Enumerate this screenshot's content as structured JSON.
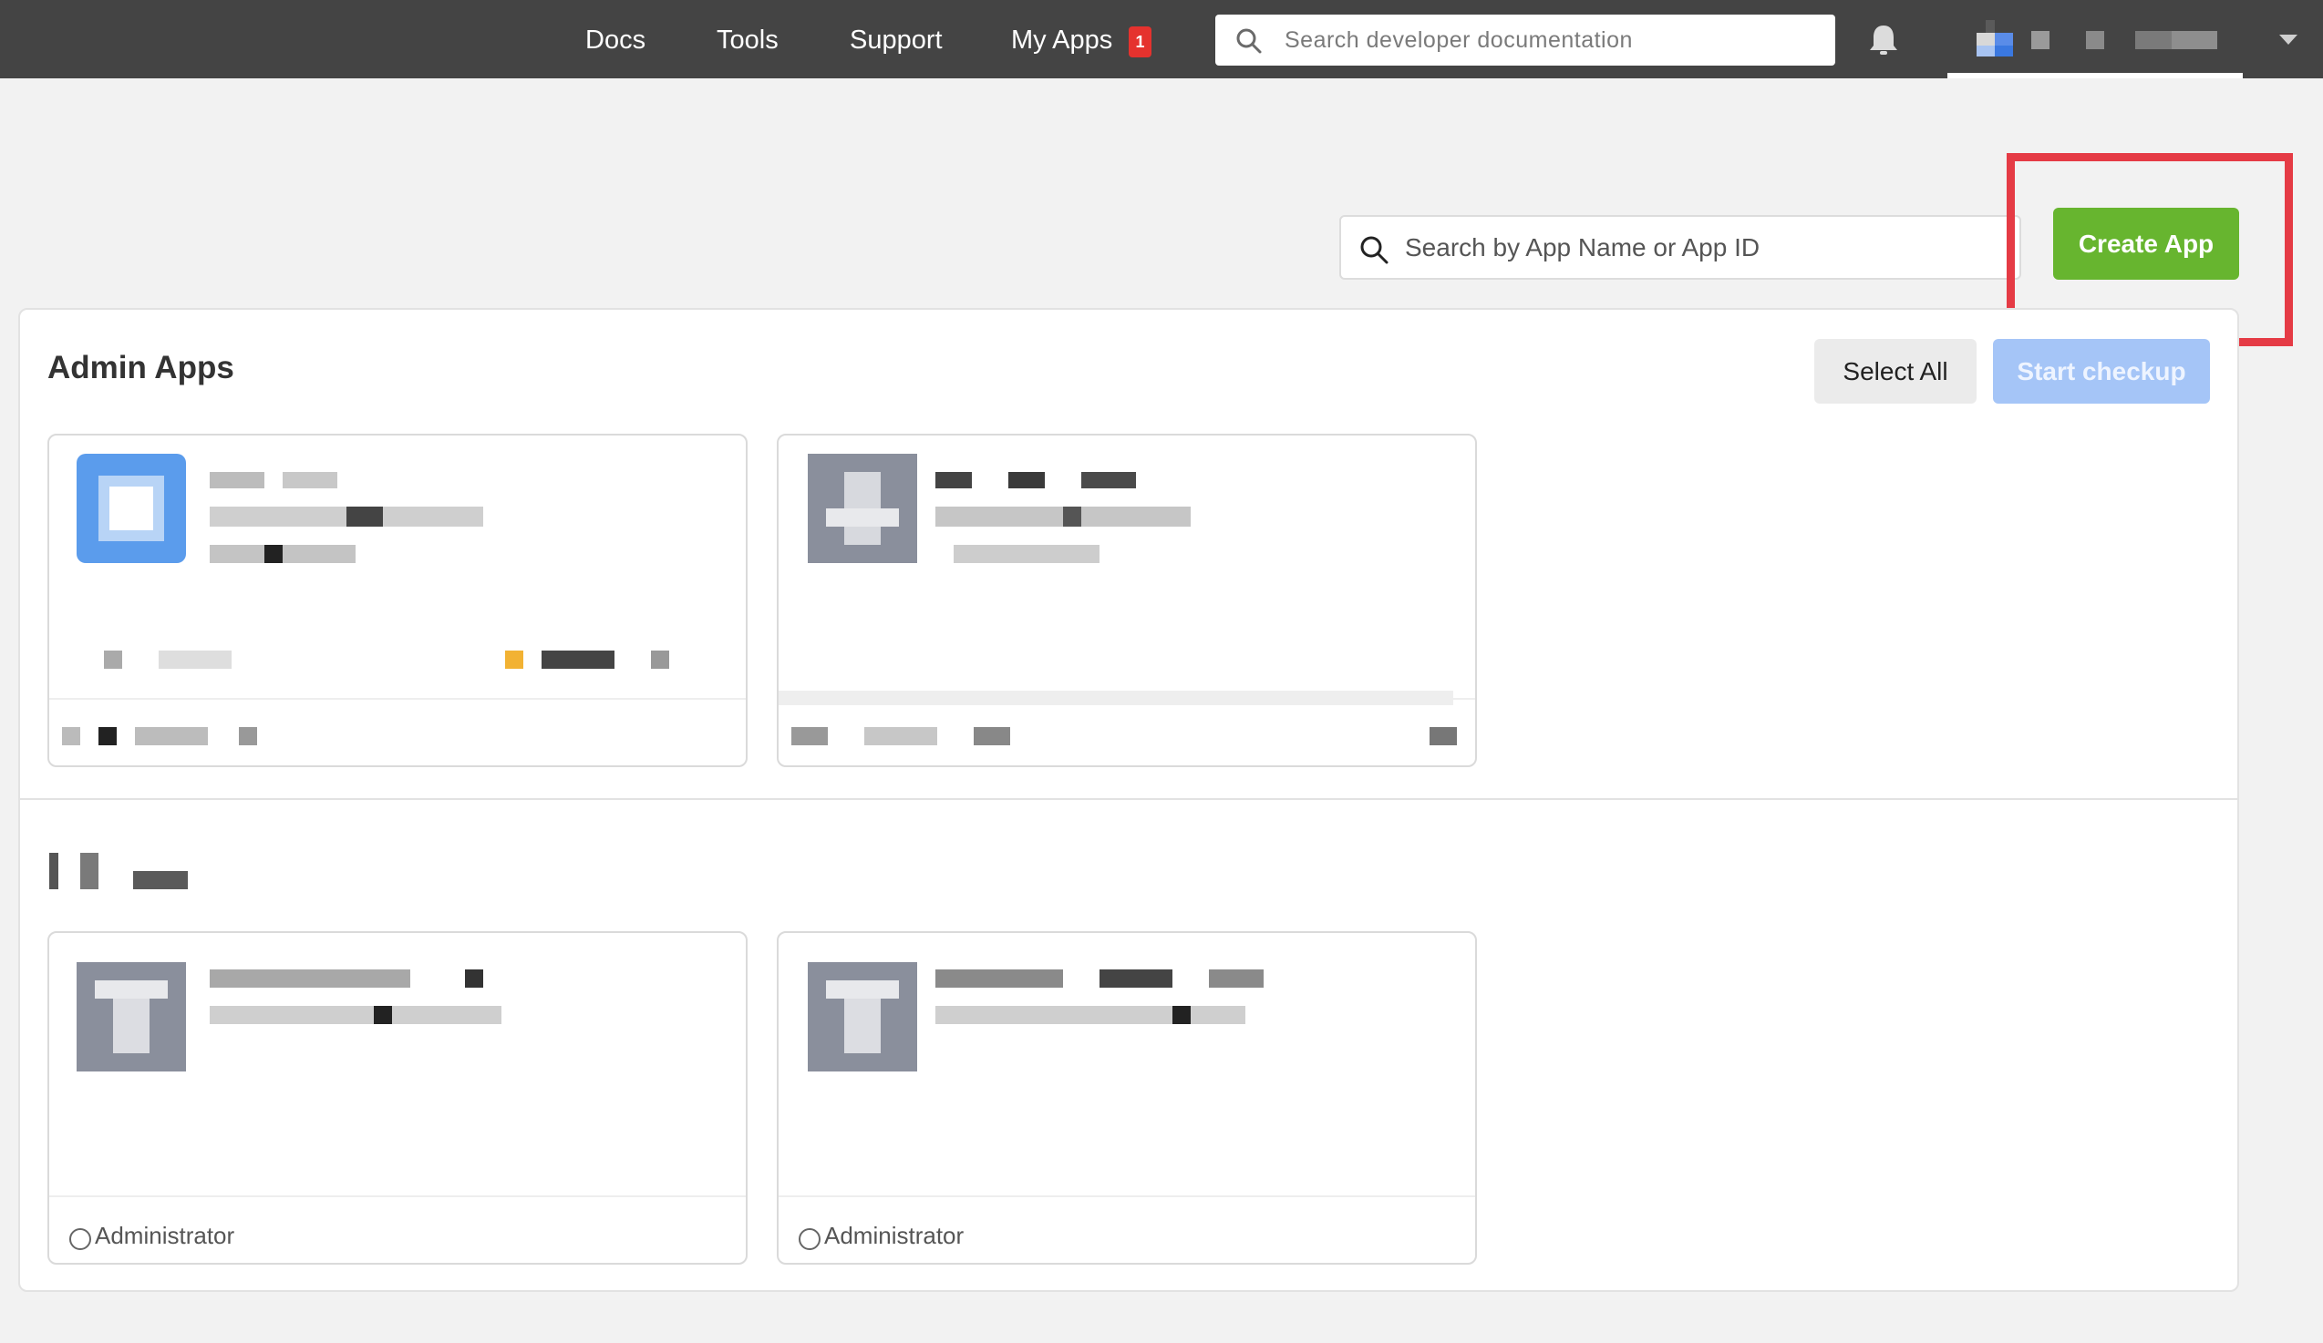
{
  "nav": {
    "items": [
      "Docs",
      "Tools",
      "Support",
      "My Apps"
    ],
    "my_apps_badge": "1",
    "search_placeholder": "Search developer documentation"
  },
  "toolbar": {
    "search_placeholder": "Search by App Name or App ID",
    "create_label": "Create App"
  },
  "admin_section": {
    "title": "Admin Apps",
    "select_all_label": "Select All",
    "start_checkup_label": "Start checkup"
  },
  "cards": [
    {
      "role": ""
    },
    {
      "role": ""
    },
    {
      "role": "Administrator"
    },
    {
      "role": "Administrator"
    }
  ],
  "colors": {
    "topbar": "#444444",
    "create_button": "#67b52f",
    "highlight": "#e53b45",
    "checkup_disabled": "#a5c5f7",
    "badge": "#e5322e"
  }
}
